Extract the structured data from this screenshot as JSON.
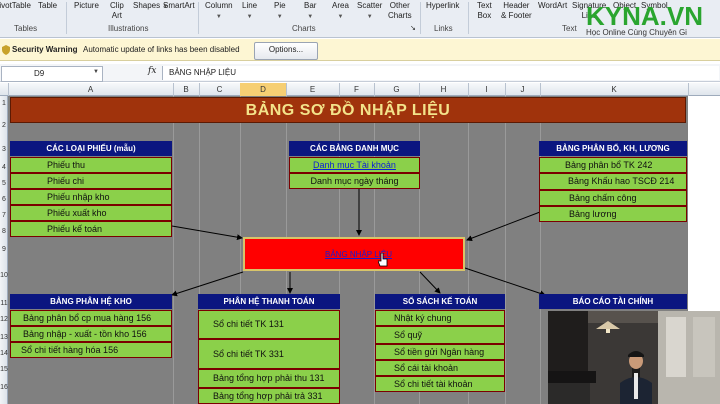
{
  "ribbon": {
    "items": [
      {
        "label": "PivotTable",
        "l2": ""
      },
      {
        "label": "Table",
        "l2": ""
      },
      {
        "label": "Picture",
        "l2": ""
      },
      {
        "label": "Clip",
        "l2": "Art"
      },
      {
        "label": "Shapes",
        "l2": ""
      },
      {
        "label": "SmartArt",
        "l2": ""
      },
      {
        "label": "Column",
        "l2": ""
      },
      {
        "label": "Line",
        "l2": ""
      },
      {
        "label": "Pie",
        "l2": ""
      },
      {
        "label": "Bar",
        "l2": ""
      },
      {
        "label": "Area",
        "l2": ""
      },
      {
        "label": "Scatter",
        "l2": ""
      },
      {
        "label": "Other",
        "l2": "Charts"
      },
      {
        "label": "Hyperlink",
        "l2": ""
      },
      {
        "label": "Text",
        "l2": "Box"
      },
      {
        "label": "Header",
        "l2": "& Footer"
      },
      {
        "label": "WordArt",
        "l2": ""
      },
      {
        "label": "Signature",
        "l2": "Line"
      },
      {
        "label": "Object",
        "l2": ""
      },
      {
        "label": "Symbol",
        "l2": ""
      }
    ],
    "groups": {
      "tables": "Tables",
      "illustrations": "Illustrations",
      "charts": "Charts",
      "links": "Links",
      "text": "Text"
    }
  },
  "logo": {
    "brand": "KYNA.VN",
    "tagline": "Học Online Cùng Chuyên Gi"
  },
  "security": {
    "title": "Security Warning",
    "message": "Automatic update of links has been disabled",
    "options_label": "Options..."
  },
  "formula_bar": {
    "name_box": "D9",
    "fx": "fx",
    "value": "BẢNG NHẬP LIỆU"
  },
  "columns": [
    "A",
    "B",
    "C",
    "D",
    "E",
    "F",
    "G",
    "H",
    "I",
    "J",
    "K"
  ],
  "selected_column": "D",
  "row_numbers": [
    "1",
    "2",
    "3",
    "4",
    "5",
    "6",
    "7",
    "8",
    "9",
    "10",
    "11",
    "12",
    "13",
    "14",
    "15",
    "16"
  ],
  "sheet": {
    "title": "BẢNG SƠ ĐỒ NHẬP LIỆU",
    "center_link": "BẢNG NHẬP LIỆU",
    "boxes": {
      "phieu": {
        "header": "CÁC LOẠI PHIẾU (mẫu)",
        "items": [
          "Phiếu thu",
          "Phiếu chi",
          "Phiếu nhập kho",
          "Phiếu xuất kho",
          "Phiếu kế toán"
        ]
      },
      "danhmuc": {
        "header": "CÁC BẢNG DANH MỤC",
        "items": [
          "Danh mục Tài khoản",
          "Danh mục ngày tháng"
        ]
      },
      "phanbo": {
        "header": "BẢNG PHÂN BỔ, KH, LƯƠNG",
        "items": [
          "Bảng phân bổ TK 242",
          "Bảng Khấu hao TSCĐ 214",
          "Bảng chấm công",
          "Bảng lương"
        ]
      },
      "kho": {
        "header": "BẢNG PHÂN HỆ KHO",
        "items": [
          "Bảng phân bổ cp mua hàng 156",
          "Bảng nhập - xuất - tồn kho 156",
          "Sổ chi tiết hàng hóa 156"
        ]
      },
      "thanhtoan": {
        "header": "PHÂN HỆ THANH TOÁN",
        "items": [
          "Sổ chi tiết  TK 131",
          "Sổ chi tiết TK 331",
          "Bảng tổng hợp phải thu 131",
          "Bảng tổng hợp phải trả 331"
        ]
      },
      "sosach": {
        "header": "SỔ SÁCH KẾ TOÁN",
        "items": [
          "Nhật ký chung",
          "Sổ quỹ",
          "Sổ tiền gửi Ngân hàng",
          "Sổ cái tài khoản",
          "Sổ chi tiết tài khoản"
        ]
      },
      "baocao": {
        "header": "BÁO CÁO TÀI CHÍNH",
        "items": []
      }
    }
  },
  "colors": {
    "title_bg": "#a0330c",
    "title_text": "#f3e38a",
    "header_bg": "#0b1680",
    "item_bg": "#8bd04a",
    "center_bg": "#ff0000"
  }
}
